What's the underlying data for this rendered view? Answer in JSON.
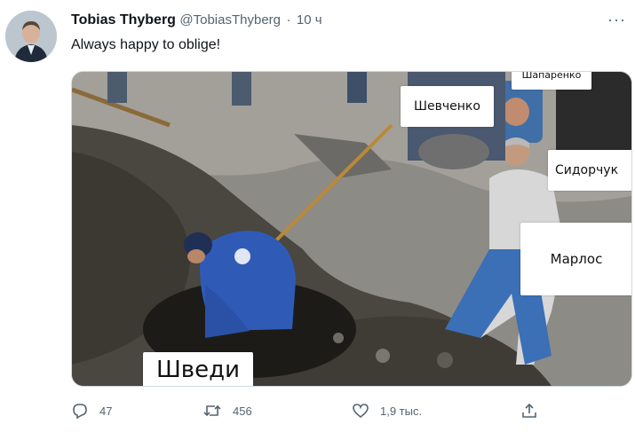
{
  "tweet": {
    "author_name": "Tobias Thyberg",
    "handle": "@TobiasThyberg",
    "separator": "·",
    "time": "10 ч",
    "more": "···",
    "text": "Always happy to oblige!"
  },
  "media": {
    "labels": {
      "top": "Шапаренко",
      "shevchenko": "Шевченко",
      "sydorchuk": "Сидорчук",
      "marlos": "Марлос",
      "swedes": "Шведи"
    }
  },
  "actions": {
    "replies": "47",
    "retweets": "456",
    "likes": "1,9 тыс."
  },
  "icons": {
    "reply": "reply-icon",
    "retweet": "retweet-icon",
    "like": "heart-icon",
    "share": "share-icon",
    "more": "more-icon"
  },
  "colors": {
    "text": "#0f1419",
    "secondary": "#536471",
    "border": "#cfd9de"
  }
}
